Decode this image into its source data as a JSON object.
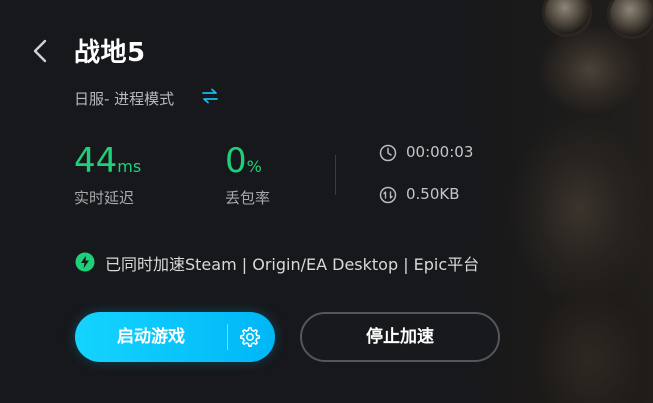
{
  "header": {
    "game_title": "战地5",
    "server_mode": "日服- 进程模式"
  },
  "stats": {
    "latency_value": "44",
    "latency_unit": "ms",
    "latency_label": "实时延迟",
    "loss_value": "0",
    "loss_unit": "%",
    "loss_label": "丢包率"
  },
  "session": {
    "duration": "00:00:03",
    "traffic": "0.50KB"
  },
  "notice": {
    "text": "已同时加速Steam | Origin/EA Desktop | Epic平台"
  },
  "actions": {
    "start_label": "启动游戏",
    "stop_label": "停止加速"
  },
  "colors": {
    "accent_green": "#1fd07a",
    "accent_cyan": "#14d4ff",
    "background": "#17181b"
  },
  "icons": [
    "back-arrow-icon",
    "swap-icon",
    "clock-icon",
    "traffic-icon",
    "lightning-icon",
    "gear-icon"
  ]
}
